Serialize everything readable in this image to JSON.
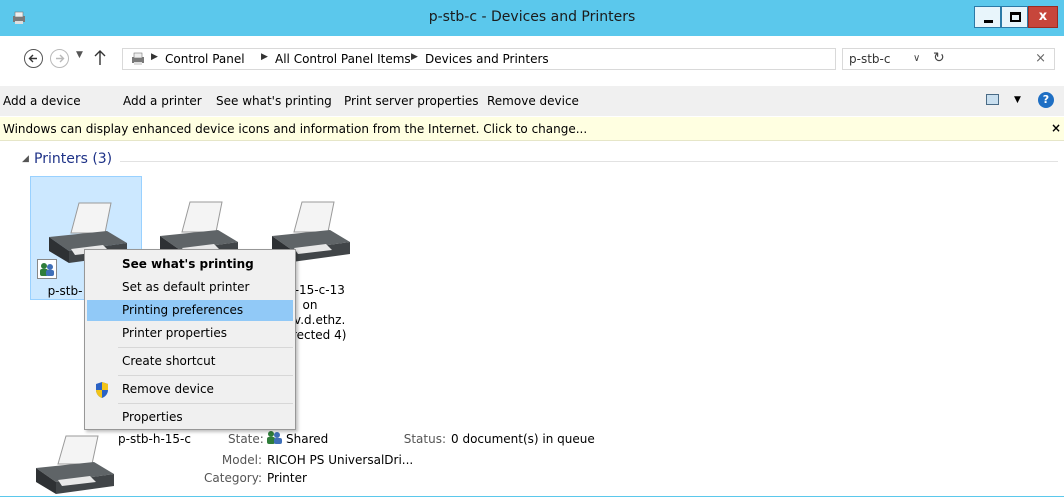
{
  "window": {
    "title": "p-stb-c - Devices and Printers",
    "close_glyph": "x"
  },
  "nav": {
    "recent_glyph": "▼",
    "up_glyph": "↑"
  },
  "address": {
    "breadcrumbs": [
      "Control Panel",
      "All Control Panel Items",
      "Devices and Printers"
    ],
    "separator_glyph": "▶",
    "dropdown_glyph": "∨",
    "refresh_glyph": "↻"
  },
  "search": {
    "value": "p-stb-c",
    "clear_glyph": "×"
  },
  "command_bar": {
    "items": [
      "Add a device",
      "Add a printer",
      "See what's printing",
      "Print server properties",
      "Remove device"
    ],
    "views_arrow_glyph": "▼",
    "help_glyph": "?"
  },
  "info_bar": {
    "text": "Windows can display enhanced device icons and information from the Internet. Click to change...",
    "close_glyph": "×"
  },
  "group": {
    "arrow_glyph": "◢",
    "title": "Printers (3)"
  },
  "devices": [
    {
      "lines": [
        "p-stb-"
      ]
    },
    {
      "lines": []
    },
    {
      "lines": [
        "p-h-15-c-13",
        "on",
        "-dev.d.ethz.",
        "edirected 4)"
      ]
    }
  ],
  "context_menu": {
    "items": [
      "See what's printing",
      "Set as default printer",
      "Printing preferences",
      "Printer properties",
      "Create shortcut",
      "Remove device",
      "Properties"
    ],
    "highlighted": "Printing preferences"
  },
  "details": {
    "name": "p-stb-h-15-c",
    "state_label": "State:",
    "state_value": "Shared",
    "status_label": "Status:",
    "status_value": "0 document(s) in queue",
    "model_label": "Model:",
    "model_value": "RICOH PS UniversalDri...",
    "category_label": "Category:",
    "category_value": "Printer"
  },
  "colors": {
    "titlebar": "#5bc8ec",
    "selection": "#cce8ff",
    "menu_highlight": "#91c9f7",
    "info_bar": "#ffffe1",
    "group_title": "#1e3287"
  }
}
